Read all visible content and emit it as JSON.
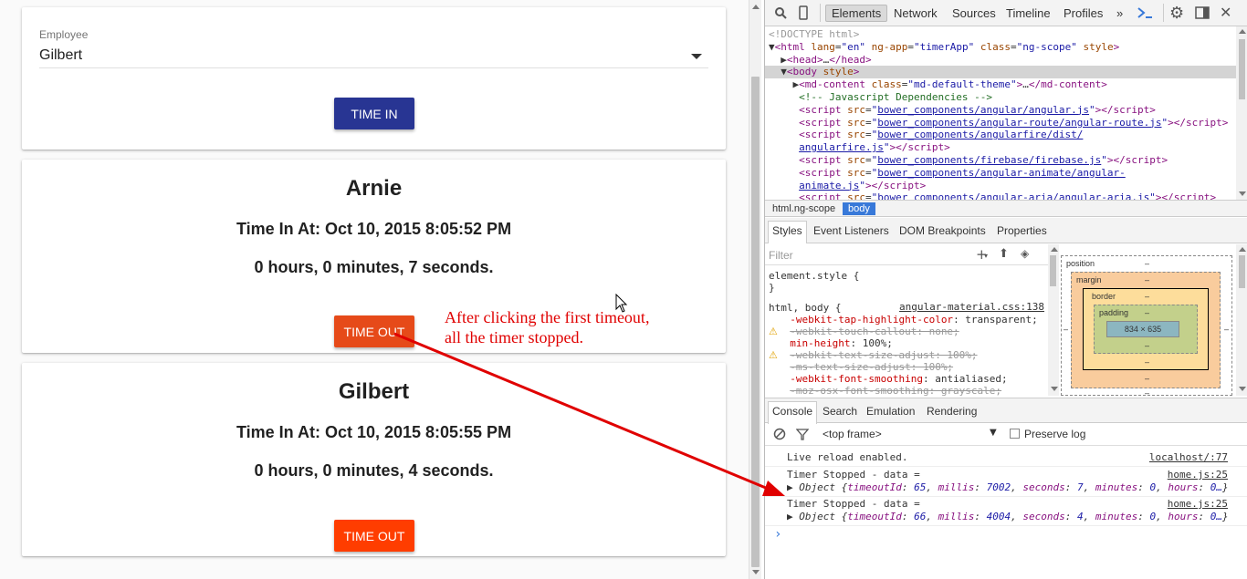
{
  "app": {
    "form": {
      "employee_label": "Employee",
      "employee_value": "Gilbert",
      "time_in_label": "TIME IN"
    },
    "employees": [
      {
        "name": "Arnie",
        "time_in": "Time In At: Oct 10, 2015 8:05:52 PM",
        "duration": "0 hours, 0 minutes, 7 seconds.",
        "timeout_label": "TIME OUT"
      },
      {
        "name": "Gilbert",
        "time_in": "Time In At: Oct 10, 2015 8:05:55 PM",
        "duration": "0 hours, 0 minutes, 4 seconds.",
        "timeout_label": "TIME OUT"
      }
    ],
    "annotation_line1": "After clicking the first timeout,",
    "annotation_line2": "all the timer stopped.",
    "colors": {
      "time_in": "#283593",
      "time_out": "#ff3d00",
      "annotation": "#e00000"
    }
  },
  "devtools": {
    "tabs": [
      "Elements",
      "Network",
      "Sources",
      "Timeline",
      "Profiles"
    ],
    "more": "»",
    "icons": [
      "search-icon",
      "device-icon",
      "console-drawer-icon",
      "gear-icon",
      "dock-icon",
      "close-icon"
    ],
    "elements": [
      {
        "html": "<span class='doc'>&lt;!DOCTYPE html&gt;</span>"
      },
      {
        "html": "▼<span class='tag'>&lt;html</span> <span class='attr'>lang</span>=<span class='val'>\"en\"</span> <span class='attr'>ng-app</span>=<span class='val'>\"timerApp\"</span> <span class='attr'>class</span>=<span class='val'>\"ng-scope\"</span> <span class='attr'>style</span><span class='tag'>&gt;</span>"
      },
      {
        "html": "&nbsp;&nbsp;▶<span class='tag'>&lt;head&gt;</span>…<span class='tag'>&lt;/head&gt;</span>"
      },
      {
        "html": "&nbsp;&nbsp;▼<span class='tag'>&lt;body</span> <span class='attr'>style</span><span class='tag'>&gt;</span>"
      },
      {
        "html": "&nbsp;&nbsp;&nbsp;&nbsp;▶<span class='tag'>&lt;md-content</span> <span class='attr'>class</span>=<span class='val'>\"md-default-theme\"</span><span class='tag'>&gt;</span>…<span class='tag'>&lt;/md-content&gt;</span>"
      },
      {
        "html": "&nbsp;&nbsp;&nbsp;&nbsp;&nbsp;<span class='cmt'>&lt;!-- Javascript Dependencies --&gt;</span>"
      },
      {
        "html": "&nbsp;&nbsp;&nbsp;&nbsp;&nbsp;<span class='tag'>&lt;script</span> <span class='attr'>src</span>=<span class='val'>\"<span class='link'>bower_components/angular/angular.js</span>\"</span><span class='tag'>&gt;&lt;/script&gt;</span>"
      },
      {
        "html": "&nbsp;&nbsp;&nbsp;&nbsp;&nbsp;<span class='tag'>&lt;script</span> <span class='attr'>src</span>=<span class='val'>\"<span class='link'>bower_components/angular-route/angular-route.js</span>\"</span><span class='tag'>&gt;&lt;/script&gt;</span>"
      },
      {
        "html": "&nbsp;&nbsp;&nbsp;&nbsp;&nbsp;<span class='tag'>&lt;script</span> <span class='attr'>src</span>=<span class='val'>\"<span class='link'>bower_components/angularfire/dist/</span></span>"
      },
      {
        "html": "&nbsp;&nbsp;&nbsp;&nbsp;&nbsp;<span class='val'><span class='link'>angularfire.js</span>\"</span><span class='tag'>&gt;&lt;/script&gt;</span>"
      },
      {
        "html": "&nbsp;&nbsp;&nbsp;&nbsp;&nbsp;<span class='tag'>&lt;script</span> <span class='attr'>src</span>=<span class='val'>\"<span class='link'>bower_components/firebase/firebase.js</span>\"</span><span class='tag'>&gt;&lt;/script&gt;</span>"
      },
      {
        "html": "&nbsp;&nbsp;&nbsp;&nbsp;&nbsp;<span class='tag'>&lt;script</span> <span class='attr'>src</span>=<span class='val'>\"<span class='link'>bower_components/angular-animate/angular-</span></span>"
      },
      {
        "html": "&nbsp;&nbsp;&nbsp;&nbsp;&nbsp;<span class='val'><span class='link'>animate.js</span>\"</span><span class='tag'>&gt;&lt;/script&gt;</span>"
      },
      {
        "html": "&nbsp;&nbsp;&nbsp;&nbsp;&nbsp;<span class='tag'>&lt;script</span> <span class='attr'>src</span>=<span class='val'>\"<span class='link'>bower_components/angular-aria/angular-aria.js</span>\"</span><span class='tag'>&gt;&lt;/script&gt;</span>"
      }
    ],
    "breadcrumbs": [
      "html.ng-scope",
      "body"
    ],
    "style_tabs": [
      "Styles",
      "Event Listeners",
      "DOM Breakpoints",
      "Properties"
    ],
    "filter_placeholder": "Filter",
    "styles": [
      {
        "html": "element.style {"
      },
      {
        "html": "}"
      },
      {
        "html": "html, body {"
      },
      {
        "html": "&nbsp;&nbsp;<span class='prop'>-webkit-tap-highlight-color</span>: transparent;"
      },
      {
        "html": "&nbsp;&nbsp;<span class='strike'>-webkit-touch-callout: none;</span>"
      },
      {
        "html": "&nbsp;&nbsp;<span class='prop'>min-height</span>: 100%;"
      },
      {
        "html": "&nbsp;&nbsp;<span class='strike'>-webkit-text-size-adjust: 100%;</span>"
      },
      {
        "html": "&nbsp;&nbsp;<span class='strike'>-ms-text-size-adjust: 100%;</span>"
      },
      {
        "html": "&nbsp;&nbsp;<span class='prop'>-webkit-font-smoothing</span>: antialiased;"
      },
      {
        "html": "&nbsp;&nbsp;<span class='strike'>-moz-osx-font-smoothing: grayscale;</span>"
      }
    ],
    "styles_source": "angular-material.css:138",
    "box_model": {
      "position": "position",
      "margin": "margin",
      "border": "border",
      "padding": "padding",
      "content": "834 × 635",
      "dash": "–"
    },
    "console_tabs": [
      "Console",
      "Search",
      "Emulation",
      "Rendering"
    ],
    "frame": "<top frame>",
    "preserve_log": "Preserve log",
    "console": {
      "live_reload": "Live reload enabled.",
      "live_reload_src": "localhost/:77",
      "stopped": "Timer Stopped - data =",
      "src": "home.js:25",
      "obj1": {
        "timeoutId": "65",
        "millis": "7002",
        "seconds": "7",
        "minutes": "0",
        "hours": "0…"
      },
      "obj2": {
        "timeoutId": "66",
        "millis": "4004",
        "seconds": "4",
        "minutes": "0",
        "hours": "0…"
      },
      "object_label": "Object",
      "prompt": "›"
    }
  }
}
